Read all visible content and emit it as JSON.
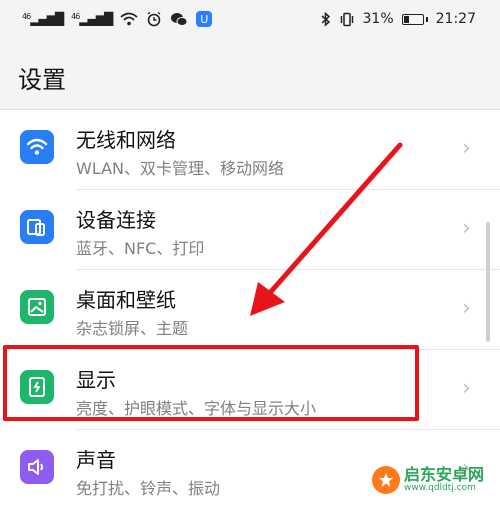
{
  "status_bar": {
    "signal1": "46",
    "signal2": "46",
    "battery_percent": "31%",
    "battery_level": 0.31,
    "time": "21:27"
  },
  "header": {
    "title": "设置"
  },
  "settings": [
    {
      "key": "wireless",
      "title": "无线和网络",
      "subtitle": "WLAN、双卡管理、移动网络",
      "icon": "wifi-icon",
      "color": "#2a7ef5"
    },
    {
      "key": "device",
      "title": "设备连接",
      "subtitle": "蓝牙、NFC、打印",
      "icon": "device-connect-icon",
      "color": "#2a7ef5"
    },
    {
      "key": "desktop",
      "title": "桌面和壁纸",
      "subtitle": "杂志锁屏、主题",
      "icon": "wallpaper-icon",
      "color": "#1fb56a"
    },
    {
      "key": "display",
      "title": "显示",
      "subtitle": "亮度、护眼模式、字体与显示大小",
      "icon": "display-icon",
      "color": "#1fb56a"
    },
    {
      "key": "sound",
      "title": "声音",
      "subtitle": "免打扰、铃声、振动",
      "icon": "speaker-icon",
      "color": "#8d5cf0"
    }
  ],
  "annotation": {
    "color": "#e8141b"
  },
  "watermark": {
    "name": "启东安卓网",
    "url": "www.qdldtj.com"
  }
}
